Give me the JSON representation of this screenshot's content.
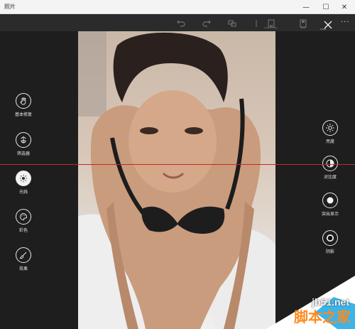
{
  "window": {
    "title": "照片",
    "min_label": "—",
    "max_label": "☐",
    "close_label": "✕"
  },
  "toolbar": {
    "icons": [
      "undo-icon",
      "redo-icon",
      "compare-icon",
      "save-copy-icon",
      "save-icon"
    ],
    "labels": [
      "Save a copy",
      "Save"
    ],
    "close_label": "Close",
    "more_label": "···"
  },
  "left_tools": [
    {
      "label": "基本修复",
      "icon": "hand-icon"
    },
    {
      "label": "筛选器",
      "icon": "filter-icon"
    },
    {
      "label": "光线",
      "icon": "sun-icon",
      "active": true
    },
    {
      "label": "彩色",
      "icon": "palette-icon"
    },
    {
      "label": "效果",
      "icon": "brush-icon"
    }
  ],
  "right_tools": [
    {
      "label": "亮度",
      "icon": "brightness-icon"
    },
    {
      "label": "对比度",
      "icon": "contrast-icon"
    },
    {
      "label": "突出显示",
      "icon": "highlight-icon"
    },
    {
      "label": "阴影",
      "icon": "shadow-icon"
    }
  ],
  "watermark": {
    "site": "jb51.net",
    "name": "脚本之家"
  },
  "colors": {
    "accent_line": "#c8262c",
    "panel": "#1e1e1e",
    "watermark_orange": "#ff8a1c",
    "watermark_blue": "#1aa7e6"
  }
}
